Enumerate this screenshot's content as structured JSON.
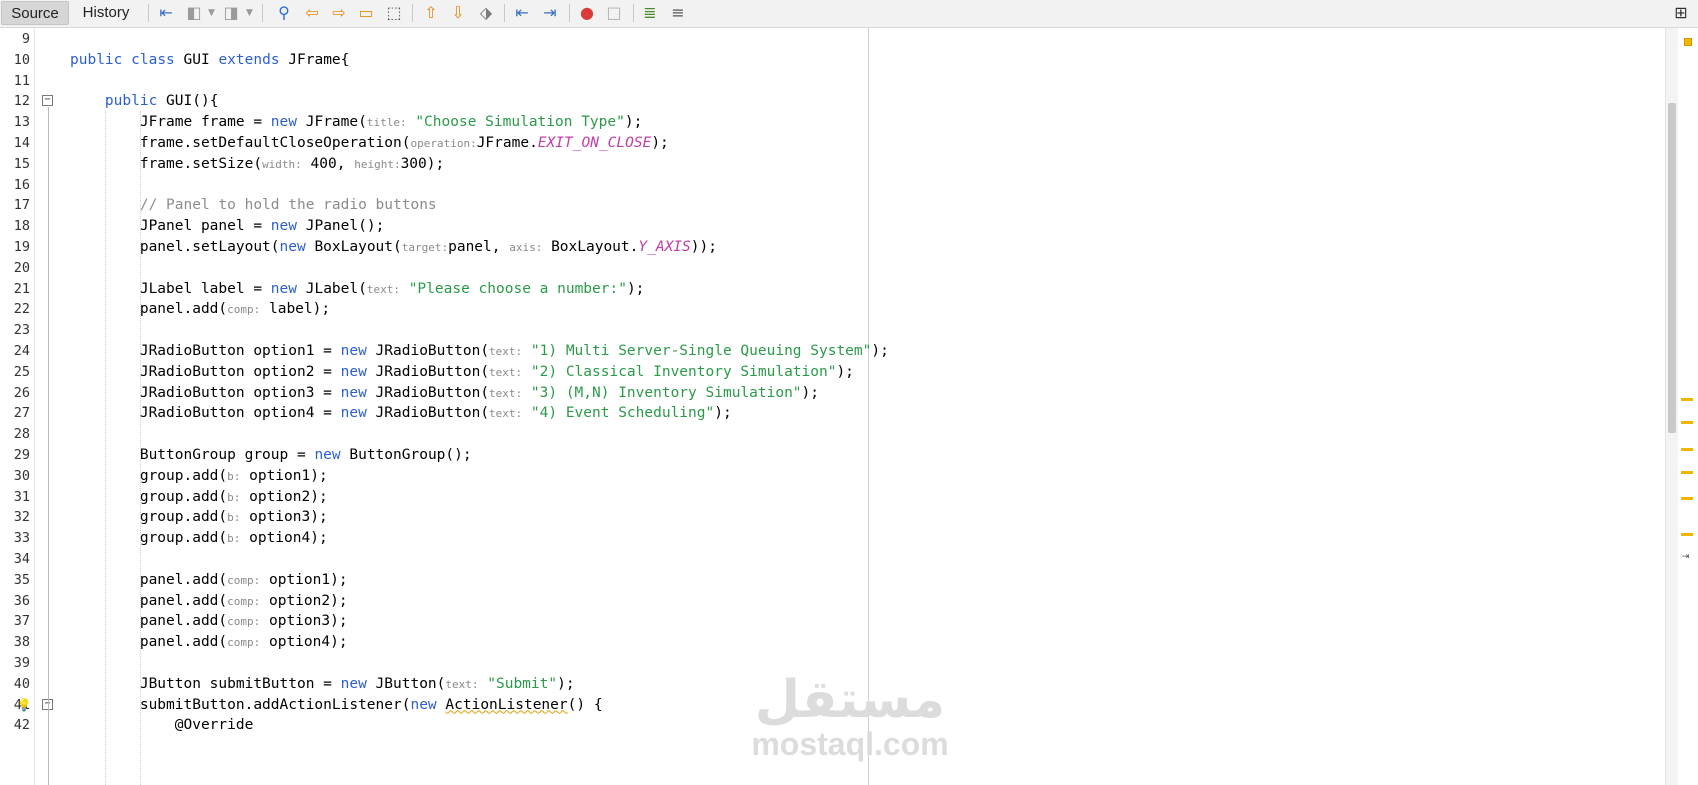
{
  "toolbar": {
    "tabs": [
      {
        "label": "Source",
        "active": true
      },
      {
        "label": "History",
        "active": false
      }
    ],
    "icons": [
      "last-edit-icon",
      "back-icon",
      "forward-icon",
      "find-icon",
      "find-previous-icon",
      "find-next-icon",
      "toggle-highlight-icon",
      "find-selection-icon",
      "previous-bookmark-icon",
      "next-bookmark-icon",
      "toggle-bookmark-icon",
      "shift-left-icon",
      "shift-right-icon",
      "start-macro-recording-icon",
      "stop-macro-recording-icon",
      "comment-icon",
      "uncomment-icon",
      "split-window-icon"
    ]
  },
  "editor": {
    "lines": [
      {
        "n": "9",
        "t": ""
      },
      {
        "n": "10",
        "t": "public class GUI extends JFrame{"
      },
      {
        "n": "11",
        "t": ""
      },
      {
        "n": "12",
        "t": "    public GUI(){"
      },
      {
        "n": "13",
        "t": "        JFrame frame = new JFrame(title: \"Choose Simulation Type\");"
      },
      {
        "n": "14",
        "t": "        frame.setDefaultCloseOperation(operation:JFrame.EXIT_ON_CLOSE);"
      },
      {
        "n": "15",
        "t": "        frame.setSize(width: 400, height:300);"
      },
      {
        "n": "16",
        "t": ""
      },
      {
        "n": "17",
        "t": "        // Panel to hold the radio buttons"
      },
      {
        "n": "18",
        "t": "        JPanel panel = new JPanel();"
      },
      {
        "n": "19",
        "t": "        panel.setLayout(new BoxLayout(target:panel, axis: BoxLayout.Y_AXIS));"
      },
      {
        "n": "20",
        "t": ""
      },
      {
        "n": "21",
        "t": "        JLabel label = new JLabel(text: \"Please choose a number:\");"
      },
      {
        "n": "22",
        "t": "        panel.add(comp: label);"
      },
      {
        "n": "23",
        "t": ""
      },
      {
        "n": "24",
        "t": "        JRadioButton option1 = new JRadioButton(text: \"1) Multi Server-Single Queuing System\");"
      },
      {
        "n": "25",
        "t": "        JRadioButton option2 = new JRadioButton(text: \"2) Classical Inventory Simulation\");"
      },
      {
        "n": "26",
        "t": "        JRadioButton option3 = new JRadioButton(text: \"3) (M,N) Inventory Simulation\");"
      },
      {
        "n": "27",
        "t": "        JRadioButton option4 = new JRadioButton(text: \"4) Event Scheduling\");"
      },
      {
        "n": "28",
        "t": ""
      },
      {
        "n": "29",
        "t": "        ButtonGroup group = new ButtonGroup();"
      },
      {
        "n": "30",
        "t": "        group.add(b: option1);"
      },
      {
        "n": "31",
        "t": "        group.add(b: option2);"
      },
      {
        "n": "32",
        "t": "        group.add(b: option3);"
      },
      {
        "n": "33",
        "t": "        group.add(b: option4);"
      },
      {
        "n": "34",
        "t": ""
      },
      {
        "n": "35",
        "t": "        panel.add(comp: option1);"
      },
      {
        "n": "36",
        "t": "        panel.add(comp: option2);"
      },
      {
        "n": "37",
        "t": "        panel.add(comp: option3);"
      },
      {
        "n": "38",
        "t": "        panel.add(comp: option4);"
      },
      {
        "n": "39",
        "t": ""
      },
      {
        "n": "40",
        "t": "        JButton submitButton = new JButton(text: \"Submit\");"
      },
      {
        "n": "41",
        "t": "        submitButton.addActionListener(new ActionListener() {"
      },
      {
        "n": "42",
        "t": "            @Override"
      }
    ],
    "syntax_colors": {
      "keyword": "#2c5fcd",
      "string": "#2b9a49",
      "comment": "#8c8c8c",
      "constant": "#c03fa8",
      "hint": "#8a8a8a"
    },
    "gutter_icons": {
      "12": "fold-collapse-icon",
      "41": "fold-collapse-icon",
      "41b": "lightbulb-warning-icon"
    }
  },
  "watermark": {
    "arabic": "مستقل",
    "latin": "mostaql.com"
  }
}
